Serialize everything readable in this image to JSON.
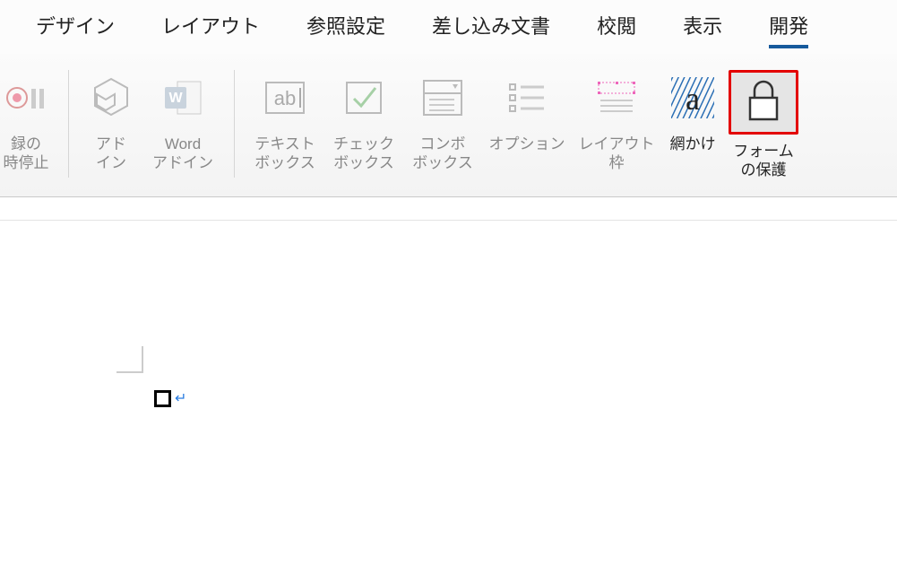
{
  "tabs": {
    "design": "デザイン",
    "layout": "レイアウト",
    "references": "参照設定",
    "mailings": "差し込み文書",
    "review": "校閲",
    "view": "表示",
    "developer": "開発"
  },
  "ribbon": {
    "record_stop": "録の\n時停止",
    "addin": "アド\nイン",
    "word_addin": "Word\nアドイン",
    "textbox": "テキスト\nボックス",
    "checkbox": "チェック\nボックス",
    "combobox": "コンボ\nボックス",
    "options": "オプション",
    "layout_frame": "レイアウト\n枠",
    "shading": "網かけ",
    "protect_form": "フォーム\nの保護"
  },
  "doc": {
    "enter_mark": "↵"
  }
}
